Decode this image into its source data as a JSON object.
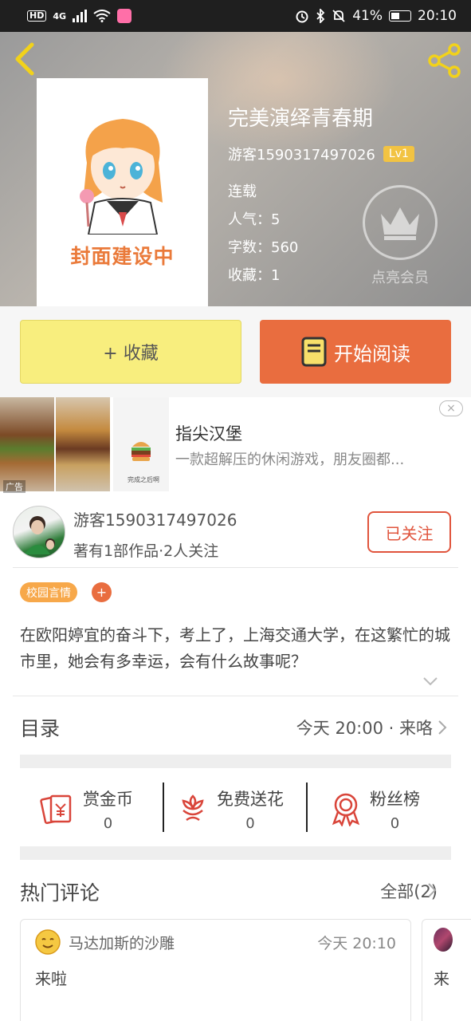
{
  "status_bar": {
    "hd": "HD",
    "network": "4G",
    "battery": "41%",
    "time": "20:10"
  },
  "book": {
    "title": "完美演绎青春期",
    "cover_text": "封面建设中",
    "author": "游客1590317497026",
    "level": "Lv1",
    "status": "连载",
    "popularity": "人气：5",
    "word_count": "字数：560",
    "favorites": "收藏：1"
  },
  "membership": {
    "label": "点亮会员"
  },
  "actions": {
    "collect_label": "+ 收藏",
    "read_label": "开始阅读"
  },
  "ad": {
    "title": "指尖汉堡",
    "description": "一款超解压的休闲游戏，朋友圈都...",
    "tag": "广告",
    "close": "×",
    "img3_caption": "完成之后啊"
  },
  "author_info": {
    "name": "游客1590317497026",
    "meta": "著有1部作品·2人关注",
    "follow_label": "已关注"
  },
  "tags": {
    "campus": "校园言情",
    "add": "+"
  },
  "synopsis": "在欧阳婷宜的奋斗下，考上了，上海交通大学，在这繁忙的城市里，她会有多幸运，会有什么故事呢？",
  "toc": {
    "label": "目录",
    "update": "今天 20:00 · 来咯"
  },
  "stats": {
    "reward": {
      "label": "赏金币",
      "value": "0"
    },
    "flowers": {
      "label": "免费送花",
      "value": "0"
    },
    "fans": {
      "label": "粉丝榜",
      "value": "0"
    }
  },
  "comments": {
    "label": "热门评论",
    "all": "全部(2)",
    "items": [
      {
        "user": "马达加斯的沙雕",
        "time": "今天 20:10",
        "text": "来啦"
      },
      {
        "text": "来"
      }
    ]
  },
  "colors": {
    "accent": "#e96d3f",
    "collect_bg": "#f8ee7e",
    "level_badge": "#f2c342",
    "tag": "#f7a84a",
    "follow": "#e0543c"
  },
  "icons": {
    "back": "back-arrow-icon",
    "share": "share-icon",
    "crown": "crown-icon",
    "book": "book-icon",
    "red_envelope": "red-envelope-icon",
    "flower": "flower-icon",
    "medal": "medal-icon",
    "chevron": "chevron-right-icon"
  }
}
